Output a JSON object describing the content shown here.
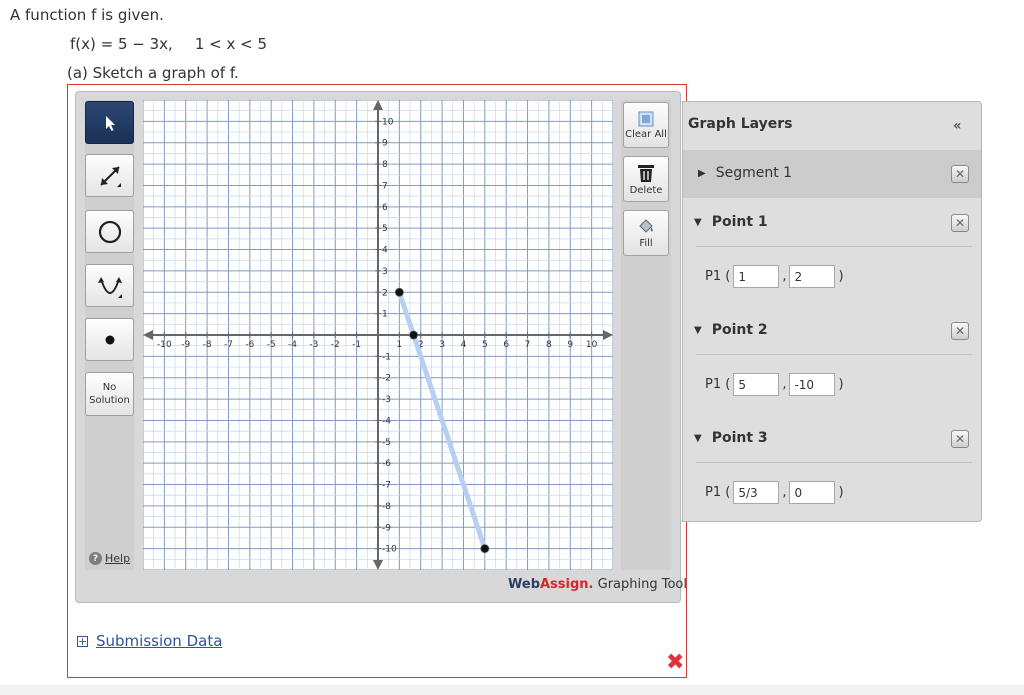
{
  "question": {
    "intro": "A function f is given.",
    "function_def": "f(x) = 5 − 3x,",
    "domain": "1 < x < 5",
    "part_a": "(a) Sketch a graph of f."
  },
  "toolbar": {
    "no_solution_line1": "No",
    "no_solution_line2": "Solution",
    "help_label": "Help"
  },
  "actions": {
    "clear_all_label": "Clear All",
    "delete_label": "Delete",
    "fill_label": "Fill"
  },
  "branding": {
    "web": "Web",
    "assign": "Assign.",
    "tool": " Graphing Tool"
  },
  "layers": {
    "title": "Graph Layers",
    "collapse_glyph": "«",
    "segment1": "Segment 1",
    "point1": {
      "label": "Point 1",
      "prefix": "P1 (",
      "x": "1",
      "y": "2"
    },
    "point2": {
      "label": "Point 2",
      "prefix": "P1 (",
      "x": "5",
      "y": "-10"
    },
    "point3": {
      "label": "Point 3",
      "prefix": "P1 (",
      "x": "5/3",
      "y": "0"
    },
    "comma": ",",
    "close_paren": ")"
  },
  "submission": {
    "label": "Submission Data"
  },
  "status": {
    "incorrect_mark": "✖"
  },
  "chart_data": {
    "type": "line",
    "xlim": [
      -11,
      11
    ],
    "ylim": [
      -11,
      11
    ],
    "grid": true,
    "x_ticks": [
      -10,
      -9,
      -8,
      -7,
      -6,
      -5,
      -4,
      -3,
      -2,
      -1,
      1,
      2,
      3,
      4,
      5,
      6,
      7,
      8,
      9,
      10
    ],
    "y_ticks": [
      10,
      9,
      8,
      7,
      6,
      5,
      4,
      3,
      2,
      1,
      -1,
      -2,
      -3,
      -4,
      -5,
      -6,
      -7,
      -8,
      -9,
      -10
    ],
    "segment": [
      [
        1,
        2
      ],
      [
        5,
        -10
      ]
    ],
    "points": [
      [
        1,
        2
      ],
      [
        1.6667,
        0
      ],
      [
        5,
        -10
      ]
    ],
    "colors": {
      "segment": "#b7cff0",
      "point": "#111111",
      "grid": "#7e9cc4"
    }
  }
}
